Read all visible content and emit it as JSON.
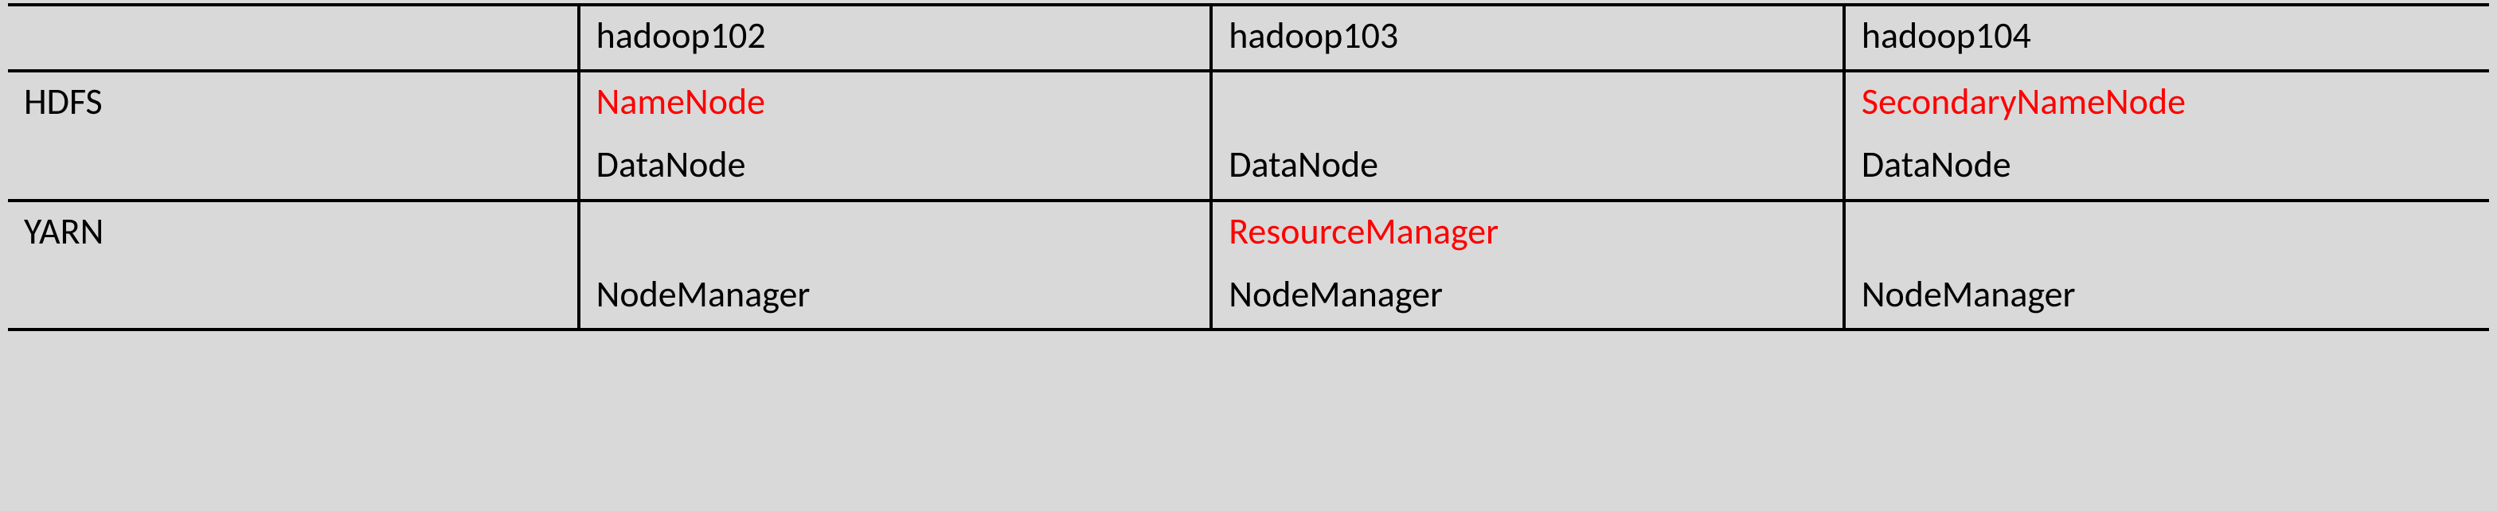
{
  "chart_data": {
    "type": "table",
    "headers": [
      "",
      "hadoop102",
      "hadoop103",
      "hadoop104"
    ],
    "rows": [
      {
        "label": "HDFS",
        "cells": [
          {
            "primary": "NameNode",
            "secondary": "DataNode"
          },
          {
            "primary": "",
            "secondary": "DataNode"
          },
          {
            "primary": "SecondaryNameNode",
            "secondary": "DataNode"
          }
        ]
      },
      {
        "label": "YARN",
        "cells": [
          {
            "primary": "",
            "secondary": "NodeManager"
          },
          {
            "primary": "ResourceManager",
            "secondary": "NodeManager"
          },
          {
            "primary": "",
            "secondary": "NodeManager"
          }
        ]
      }
    ],
    "highlight_color": "#ff0000"
  },
  "headers": {
    "col0": "",
    "col1": "hadoop102",
    "col2": "hadoop103",
    "col3": "hadoop104"
  },
  "sections": {
    "hdfs": {
      "label": "HDFS",
      "h102_primary": "NameNode",
      "h102_secondary": "DataNode",
      "h103_primary": "",
      "h103_secondary": "DataNode",
      "h104_primary": "SecondaryNameNode",
      "h104_secondary": "DataNode"
    },
    "yarn": {
      "label": "YARN",
      "h102_primary": "",
      "h102_secondary": "NodeManager",
      "h103_primary": "ResourceManager",
      "h103_secondary": "NodeManager",
      "h104_primary": "",
      "h104_secondary": "NodeManager"
    }
  }
}
